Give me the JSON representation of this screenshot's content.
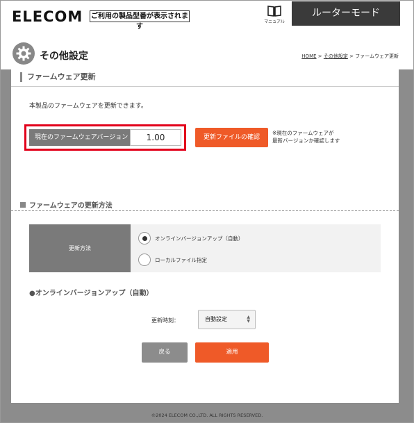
{
  "header": {
    "logo": "ELECOM",
    "model_text": "ご利用の製品型番が表示されます",
    "manual_label": "マニュアル",
    "mode_label": "ルーターモード"
  },
  "page": {
    "title": "その他設定",
    "breadcrumb": {
      "home": "HOME",
      "sep1": " > ",
      "parent": "その他設定",
      "sep2": " > ",
      "current": "ファームウェア更新"
    }
  },
  "firmware": {
    "section_title": "ファームウェア更新",
    "description": "本製品のファームウェアを更新できます。",
    "version_label": "現在のファームウェアバージョン",
    "version_value": "1.00",
    "check_button": "更新ファイルの確認",
    "note_line1": "※現在のファームウェアが",
    "note_line2": "最新バージョンか確認します"
  },
  "update_method": {
    "section_title": "ファームウェアの更新方法",
    "label": "更新方法",
    "options": [
      {
        "label": "オンラインバージョンアップ（自動）",
        "selected": true
      },
      {
        "label": "ローカルファイル指定",
        "selected": false
      }
    ]
  },
  "online": {
    "title": "●オンラインバージョンアップ（自動）",
    "time_label": "更新時刻：",
    "time_value": "自動設定"
  },
  "buttons": {
    "back": "戻る",
    "apply": "適用"
  },
  "footer": {
    "copyright": "©2024 ELECOM CO.,LTD. ALL RIGHTS RESERVED."
  },
  "colors": {
    "accent": "#ef5a28",
    "highlight_border": "#e2001a",
    "label_bg": "#7a7a7a",
    "frame_gray": "#8c8c8c"
  },
  "icons": {
    "manual": "book-icon",
    "title": "gear-icon",
    "select": "updown-arrows-icon"
  }
}
